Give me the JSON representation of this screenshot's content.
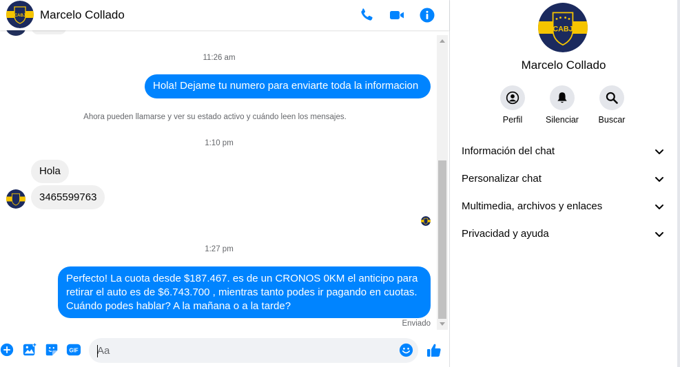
{
  "contact": {
    "name": "Marcelo Collado",
    "avatar_text": "CABJ"
  },
  "header": {
    "call_icon": "phone-icon",
    "video_icon": "video-camera-icon",
    "info_icon": "info-icon"
  },
  "messages": [
    {
      "type": "timestamp",
      "text": "11:26 am"
    },
    {
      "type": "outgoing",
      "text": "Hola! Dejame tu numero  para enviarte toda la informacion"
    },
    {
      "type": "system",
      "text": "Ahora pueden llamarse y ver su estado activo y cuándo leen los mensajes."
    },
    {
      "type": "timestamp",
      "text": "1:10 pm"
    },
    {
      "type": "incoming",
      "text": "Hola"
    },
    {
      "type": "incoming",
      "text": "3465599763"
    },
    {
      "type": "timestamp",
      "text": "1:27 pm"
    },
    {
      "type": "outgoing",
      "lines": [
        "Perfecto! La cuota desde $187.467. es de un CRONOS 0KM el anticipo para",
        "retirar el auto es de $6.743.700 , mientras tanto podes ir pagando en cuotas.",
        "Cuándo podes hablar? A la mañana o a la tarde?"
      ]
    }
  ],
  "status": "Enviado",
  "composer": {
    "placeholder": "Aa",
    "icons": [
      "plus-circle-icon",
      "photo-icon",
      "sticker-icon",
      "gif-icon",
      "emoji-icon",
      "thumbs-up-icon"
    ],
    "gif_label": "GIF"
  },
  "info_panel": {
    "actions": [
      {
        "label": "Perfil",
        "icon": "profile-icon"
      },
      {
        "label": "Silenciar",
        "icon": "bell-icon"
      },
      {
        "label": "Buscar",
        "icon": "search-icon"
      }
    ],
    "sections": [
      {
        "label": "Información del chat"
      },
      {
        "label": "Personalizar chat"
      },
      {
        "label": "Multimedia, archivos y enlaces"
      },
      {
        "label": "Privacidad y ayuda"
      }
    ]
  },
  "colors": {
    "accent": "#0084ff",
    "incoming_bubble": "#f0f0f0",
    "avatar_navy": "#1b2a5e",
    "avatar_gold": "#f5c400"
  }
}
